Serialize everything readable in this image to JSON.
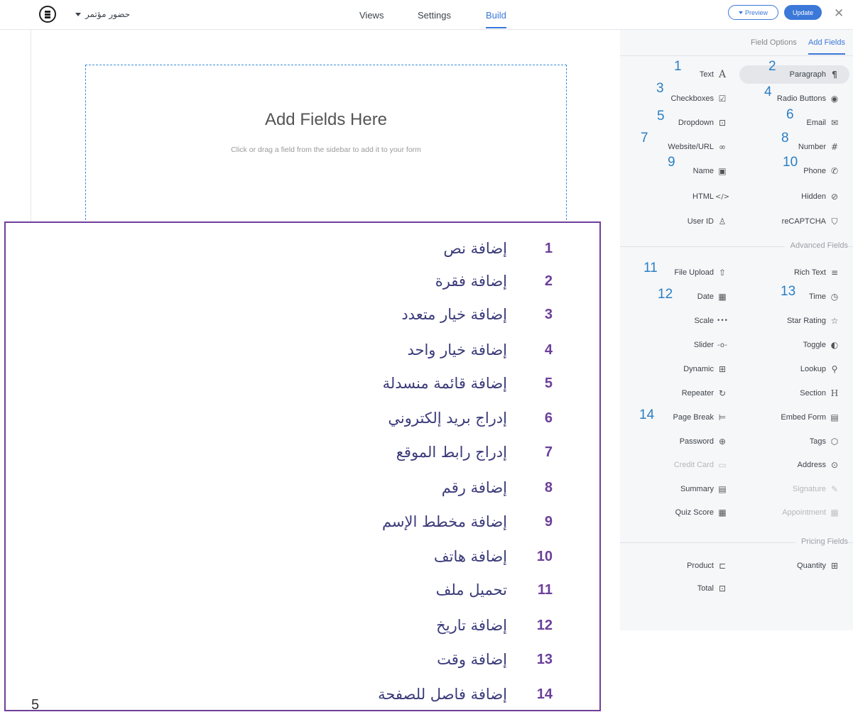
{
  "header": {
    "form_title": "حضور مؤتمر",
    "tabs": [
      "Views",
      "Settings",
      "Build"
    ],
    "active_tab": "Build",
    "preview_label": "Preview",
    "update_label": "Update",
    "close_glyph": "✕",
    "accent": "#3b78d8"
  },
  "canvas": {
    "title": "Add Fields Here",
    "subtitle": "Click or drag a field from the sidebar to add it to your form"
  },
  "sidebar": {
    "tabs": [
      "Field Options",
      "Add Fields"
    ],
    "active_tab": "Add Fields",
    "basic_fields": [
      {
        "label": "Text",
        "icon": "text-icon",
        "num": "1"
      },
      {
        "label": "Paragraph",
        "icon": "paragraph-icon",
        "num": "2"
      },
      {
        "label": "Checkboxes",
        "icon": "checkbox-icon",
        "num": "3"
      },
      {
        "label": "Radio Buttons",
        "icon": "radio-icon",
        "num": "4"
      },
      {
        "label": "Dropdown",
        "icon": "dropdown-icon",
        "num": "5"
      },
      {
        "label": "Email",
        "icon": "email-icon",
        "num": "6"
      },
      {
        "label": "Website/URL",
        "icon": "link-icon",
        "num": "7"
      },
      {
        "label": "Number",
        "icon": "hash-icon",
        "num": "8"
      },
      {
        "label": "Name",
        "icon": "name-card-icon",
        "num": "9"
      },
      {
        "label": "Phone",
        "icon": "phone-icon",
        "num": "10"
      },
      {
        "label": "HTML",
        "icon": "code-icon"
      },
      {
        "label": "Hidden",
        "icon": "eye-off-icon"
      },
      {
        "label": "User ID",
        "icon": "user-icon"
      },
      {
        "label": "reCAPTCHA",
        "icon": "shield-check-icon"
      }
    ],
    "advanced_heading": "Advanced Fields",
    "advanced_fields": [
      {
        "label": "File Upload",
        "icon": "upload-icon",
        "num": "11"
      },
      {
        "label": "Rich Text",
        "icon": "rich-text-icon"
      },
      {
        "label": "Date",
        "icon": "calendar-icon",
        "num": "12"
      },
      {
        "label": "Time",
        "icon": "clock-icon",
        "num": "13"
      },
      {
        "label": "Scale",
        "icon": "scale-icon"
      },
      {
        "label": "Star Rating",
        "icon": "star-icon"
      },
      {
        "label": "Slider",
        "icon": "slider-icon"
      },
      {
        "label": "Toggle",
        "icon": "toggle-icon"
      },
      {
        "label": "Dynamic",
        "icon": "hierarchy-icon"
      },
      {
        "label": "Lookup",
        "icon": "search-icon"
      },
      {
        "label": "Repeater",
        "icon": "repeat-icon"
      },
      {
        "label": "Section",
        "icon": "heading-icon"
      },
      {
        "label": "Page Break",
        "icon": "page-break-icon",
        "num": "14"
      },
      {
        "label": "Embed Form",
        "icon": "document-icon"
      },
      {
        "label": "Password",
        "icon": "lock-icon"
      },
      {
        "label": "Tags",
        "icon": "tag-icon"
      },
      {
        "label": "Credit Card",
        "icon": "credit-card-icon",
        "disabled": true
      },
      {
        "label": "Address",
        "icon": "map-pin-icon"
      },
      {
        "label": "Summary",
        "icon": "document-icon"
      },
      {
        "label": "Signature",
        "icon": "pen-icon",
        "disabled": true
      },
      {
        "label": "Quiz Score",
        "icon": "calculator-icon"
      },
      {
        "label": "Appointment",
        "icon": "calendar-icon",
        "disabled": true
      }
    ],
    "pricing_heading": "Pricing Fields",
    "pricing_fields": [
      {
        "label": "Product",
        "icon": "cart-icon"
      },
      {
        "label": "Quantity",
        "icon": "plus-box-icon"
      },
      {
        "label": "Total",
        "icon": "total-icon"
      }
    ]
  },
  "legend": [
    {
      "num": "1",
      "text": "إضافة نص"
    },
    {
      "num": "2",
      "text": "إضافة  فقرة"
    },
    {
      "num": "3",
      "text": "إضافة خيار متعدد"
    },
    {
      "num": "4",
      "text": "إضافة خيار واحد"
    },
    {
      "num": "5",
      "text": "إضافة قائمة منسدلة"
    },
    {
      "num": "6",
      "text": "إدراج بريد إلكتروني"
    },
    {
      "num": "7",
      "text": "إدراج رابط الموقع"
    },
    {
      "num": "8",
      "text": "إضافة رقم"
    },
    {
      "num": "9",
      "text": "إضافة مخطط الإسم"
    },
    {
      "num": "10",
      "text": "إضافة هاتف"
    },
    {
      "num": "11",
      "text": "تحميل ملف"
    },
    {
      "num": "12",
      "text": "إضافة تاريخ"
    },
    {
      "num": "13",
      "text": "إضافة وقت"
    },
    {
      "num": "14",
      "text": "إضافة فاصل للصفحة"
    }
  ],
  "stray_mark": "5"
}
